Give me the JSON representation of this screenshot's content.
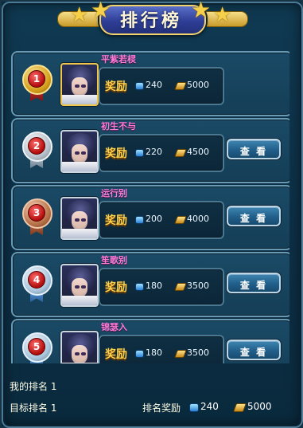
{
  "title": "排行榜",
  "labels": {
    "reward": "奖励",
    "view_button": "查 看",
    "my_rank": "我的排名",
    "target_rank": "目标排名",
    "rank_reward": "排名奖励"
  },
  "rows": [
    {
      "rank": "1",
      "name": "平紫若棂",
      "gems": "240",
      "gold": "5000",
      "medal": "gold",
      "has_view": false
    },
    {
      "rank": "2",
      "name": "初生不与",
      "gems": "220",
      "gold": "4500",
      "medal": "silver",
      "has_view": true
    },
    {
      "rank": "3",
      "name": "运行别",
      "gems": "200",
      "gold": "4000",
      "medal": "bronze",
      "has_view": true
    },
    {
      "rank": "4",
      "name": "笙歌别",
      "gems": "180",
      "gold": "3500",
      "medal": "blue",
      "has_view": true
    },
    {
      "rank": "5",
      "name": "锦瑟入",
      "gems": "180",
      "gold": "3500",
      "medal": "blue",
      "has_view": true
    }
  ],
  "footer": {
    "my_rank_value": "1",
    "target_rank_value": "1",
    "reward_gems": "240",
    "reward_gold": "5000"
  },
  "icons": {
    "gem": "gem-icon",
    "gold": "gold-ingot-icon",
    "star": "star-icon"
  },
  "colors": {
    "accent_gold": "#ffd04a",
    "name_pink": "#ff7ad9",
    "panel_bg": "#0f3a52"
  }
}
